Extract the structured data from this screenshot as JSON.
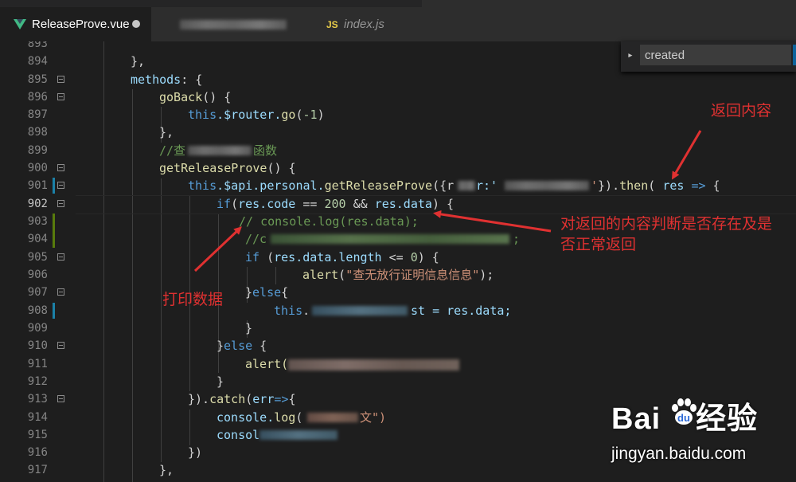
{
  "tabs": [
    {
      "label": "ReleaseProve.vue",
      "icon": "vue-icon",
      "modified": true,
      "active": true
    },
    {
      "label": "",
      "icon": "lines-icon",
      "active": false
    },
    {
      "label": "index.js",
      "icon": "js-icon",
      "active": false
    }
  ],
  "search": {
    "value": "created",
    "expand_icon": "chevron-right-icon"
  },
  "gutter": {
    "line_numbers": [
      "893",
      "894",
      "895",
      "896",
      "897",
      "898",
      "899",
      "900",
      "901",
      "902",
      "903",
      "904",
      "905",
      "906",
      "907",
      "908",
      "909",
      "910",
      "911",
      "912",
      "913",
      "914",
      "915",
      "916",
      "917"
    ],
    "current_line": "902"
  },
  "code": {
    "l894_close": "},",
    "l895_methods": "methods",
    "l895_rest": ": {",
    "l896_fn": "goBack",
    "l896_rest": "() {",
    "l897_this": "this",
    "l897_router": ".$router.",
    "l897_go": "go",
    "l897_num": "-1",
    "l898": "},",
    "l899_a": "//查",
    "l899_b": "函数",
    "l900_fn": "getReleaseProve",
    "l900_rest": "() {",
    "l901_this": "this",
    "l901_api": ".$api.personal.",
    "l901_fn": "getReleaseProve",
    "l901_open": "({r",
    "l901_key": "r:'",
    "l901_then_close": "'}).",
    "l901_then": "then",
    "l901_res": "res",
    "l901_arrow": "=>",
    "l901_brace": "{",
    "l902_if": "if",
    "l902_res": "res.code",
    "l902_eq": " == ",
    "l902_num": "200",
    "l902_and": " && ",
    "l902_data": "res.data",
    "l902_tail": ") {",
    "l903": "// console.log(res.data);",
    "l904_a": "//c",
    "l904_b": ";",
    "l905_if": "if",
    "l905_cond": "res.data.length",
    "l905_op": " <= ",
    "l905_num": "0",
    "l905_tail": ") {",
    "l906_fn": "alert",
    "l906_str": "\"查无放行证明信息信息\"",
    "l906_tail": ");",
    "l907_else": "}else{",
    "l908_this": "this",
    "l908_rest": "st = res.data;",
    "l909": "}",
    "l910_else": "}else {",
    "l911_fn": "alert(",
    "l912": "}",
    "l913_a": "}).",
    "l913_catch": "catch",
    "l913_err": "err",
    "l913_arrow": "=>",
    "l913_tail": "{",
    "l914_console": "console.",
    "l914_log": "log",
    "l914_str": "文\")",
    "l915": "consol",
    "l916": "})",
    "l917": "},"
  },
  "annotations": {
    "return_content": "返回内容",
    "check_line1": "对返回的内容判断是否存在及是",
    "check_line2": "否正常返回",
    "print_data": "打印数据"
  },
  "watermark": {
    "logo_left": "Bai",
    "logo_right": "经验",
    "url": "jingyan.baidu.com"
  },
  "colors": {
    "accent_red": "#e03131",
    "editor_bg": "#1e1e1e",
    "keyword": "#569cd6",
    "function": "#dcdcaa",
    "comment": "#6a9955",
    "string": "#ce9178",
    "number": "#b5cea8"
  }
}
